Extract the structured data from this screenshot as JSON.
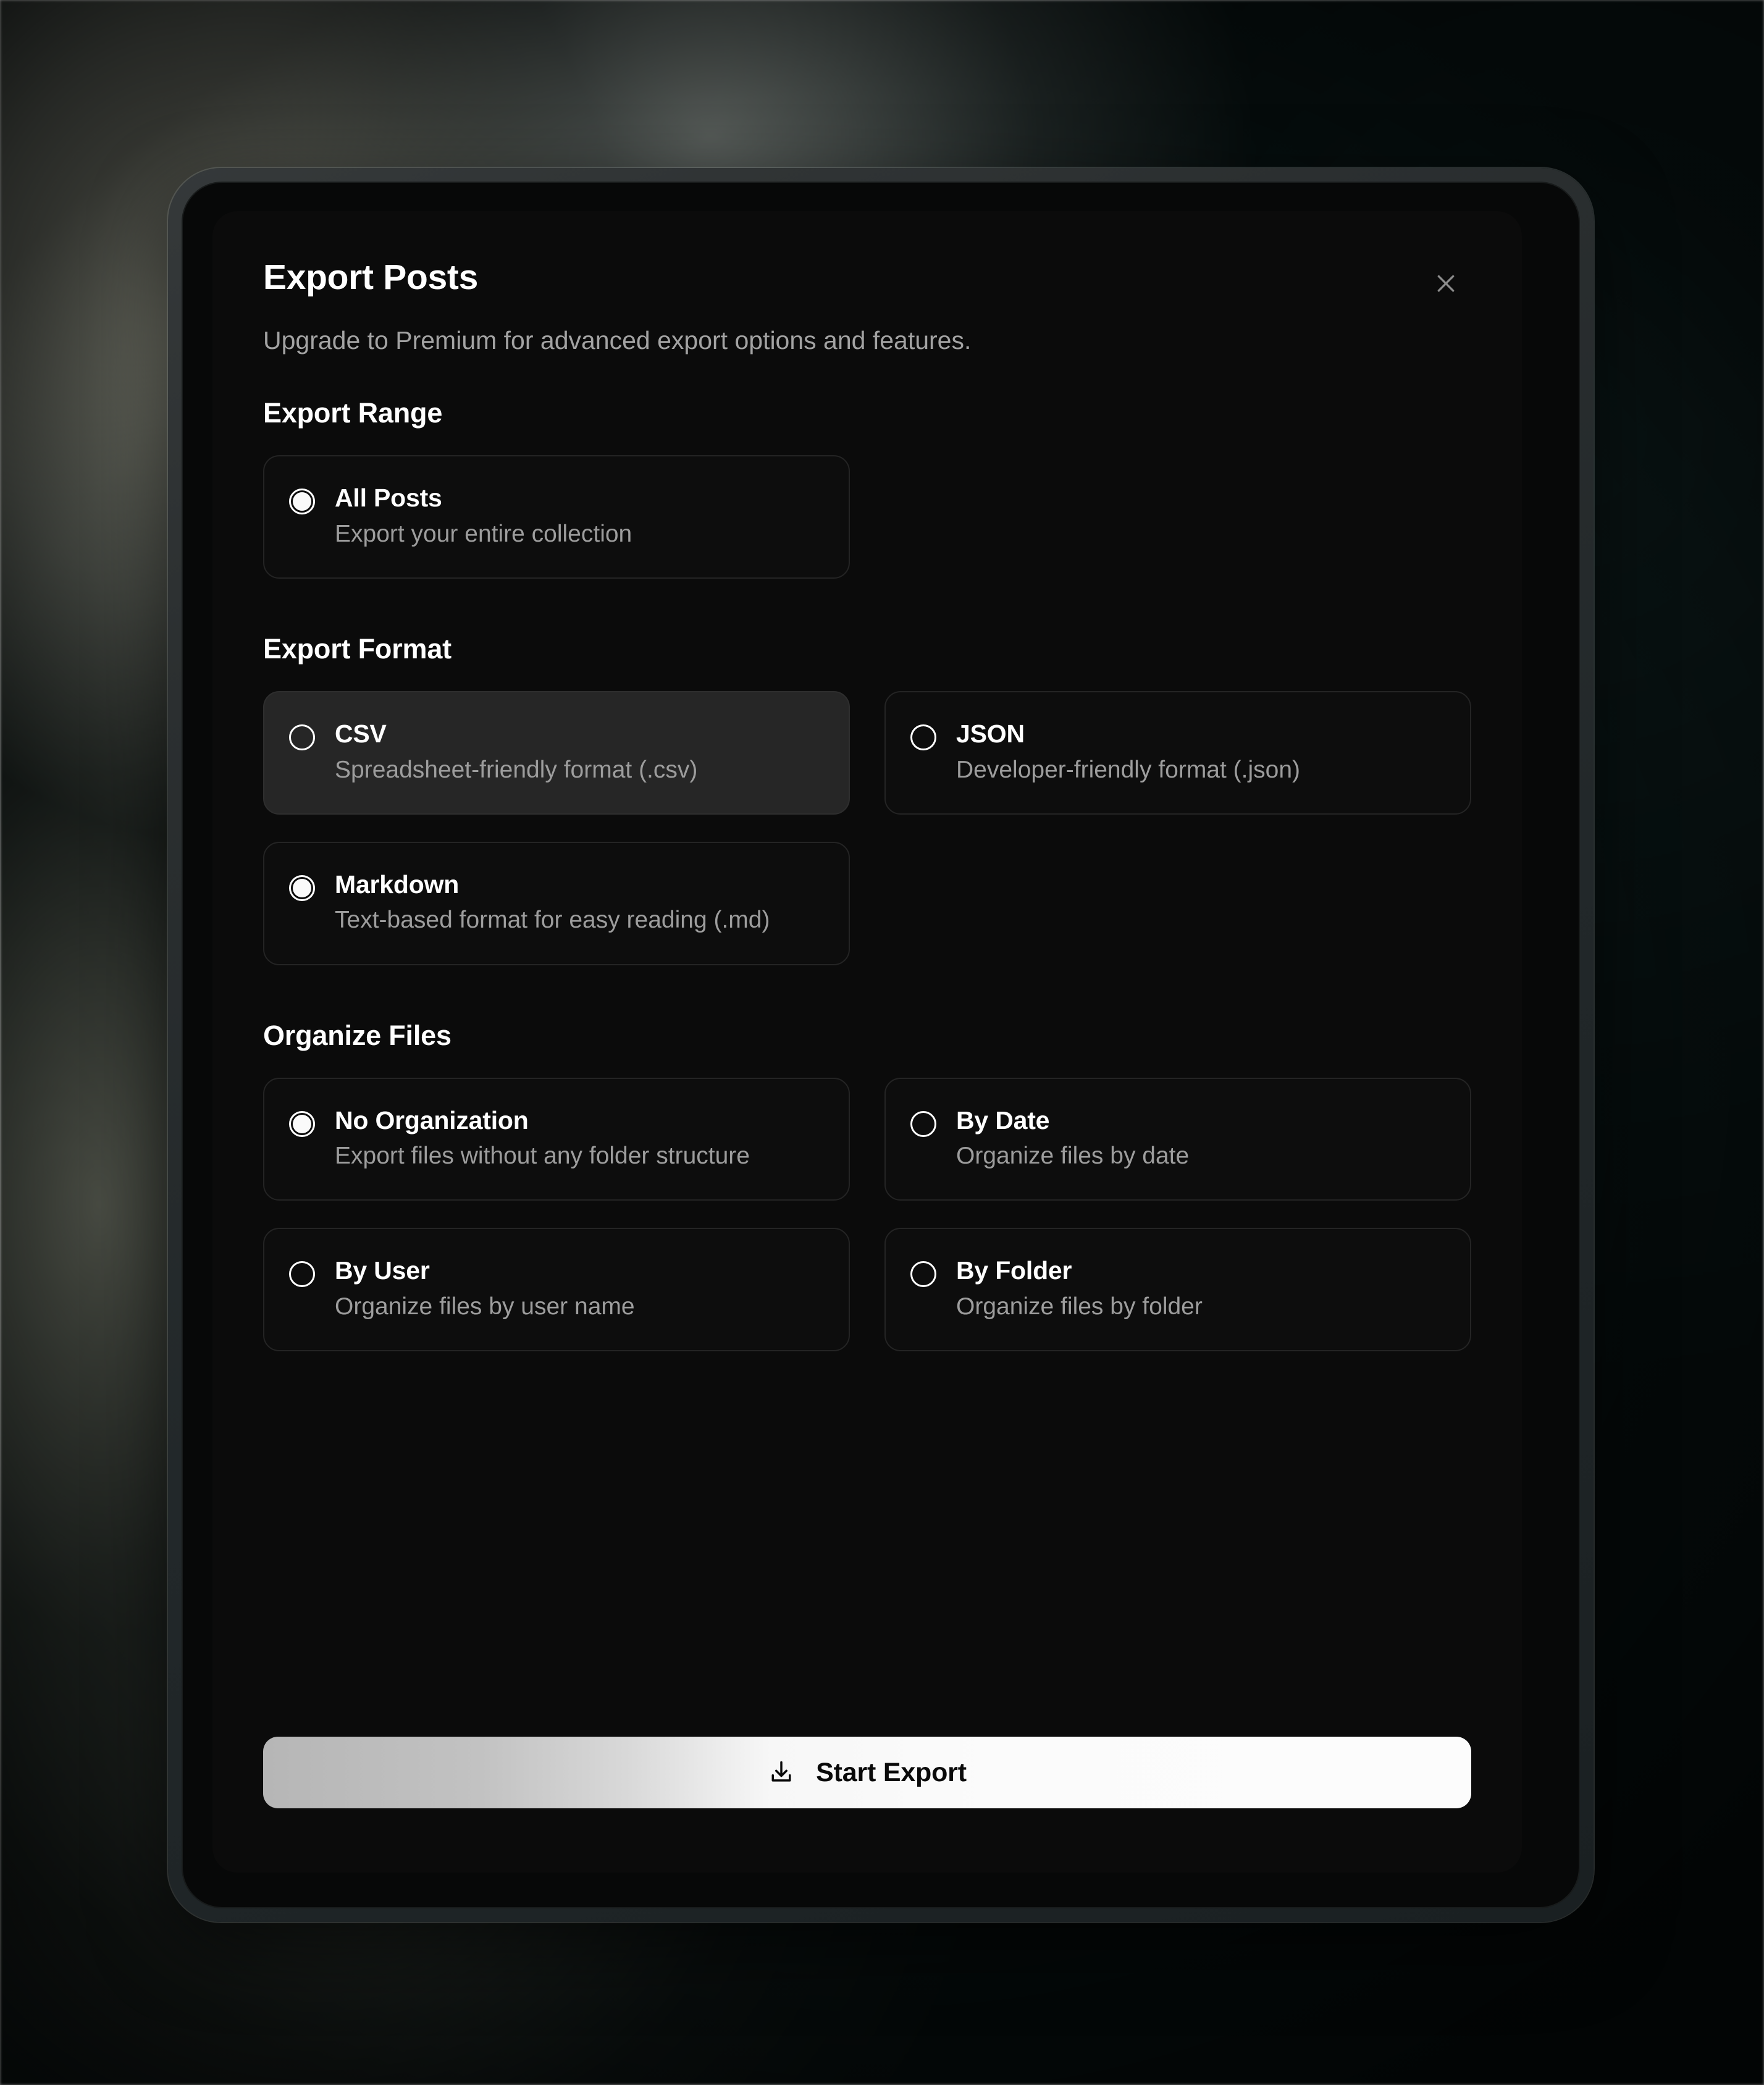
{
  "background": {
    "accent_left": "#6e7364",
    "accent_right": "#0b1413"
  },
  "theme": {
    "sheet_bg": "#0b0b0b",
    "card_bg": "#0d0d0d",
    "card_hover_bg": "#262626",
    "card_border": "#242424",
    "text_primary": "#ffffff",
    "text_secondary": "#9d9d9d",
    "cta_gradient_from": "#b6b6b6",
    "cta_gradient_to": "#fcfcfc"
  },
  "dialog": {
    "title": "Export Posts",
    "subtitle": "Upgrade to Premium for advanced export options and features.",
    "close_icon": "close-icon"
  },
  "sections": [
    {
      "id": "export-range",
      "heading": "Export Range",
      "options": [
        {
          "id": "all-posts",
          "label": "All Posts",
          "description": "Export your entire collection",
          "selected": true,
          "hovered": false
        }
      ]
    },
    {
      "id": "export-format",
      "heading": "Export Format",
      "options": [
        {
          "id": "csv",
          "label": "CSV",
          "description": "Spreadsheet-friendly format (.csv)",
          "selected": false,
          "hovered": true
        },
        {
          "id": "json",
          "label": "JSON",
          "description": "Developer-friendly format (.json)",
          "selected": false,
          "hovered": false
        },
        {
          "id": "markdown",
          "label": "Markdown",
          "description": "Text-based format for easy reading (.md)",
          "selected": true,
          "hovered": false
        }
      ]
    },
    {
      "id": "organize-files",
      "heading": "Organize Files",
      "options": [
        {
          "id": "no-organization",
          "label": "No Organization",
          "description": "Export files without any folder structure",
          "selected": true,
          "hovered": false
        },
        {
          "id": "by-date",
          "label": "By Date",
          "description": "Organize files by date",
          "selected": false,
          "hovered": false
        },
        {
          "id": "by-user",
          "label": "By User",
          "description": "Organize files by user name",
          "selected": false,
          "hovered": false
        },
        {
          "id": "by-folder",
          "label": "By Folder",
          "description": "Organize files by folder",
          "selected": false,
          "hovered": false
        }
      ]
    }
  ],
  "primary_action": {
    "label": "Start Export",
    "icon": "download-icon"
  }
}
